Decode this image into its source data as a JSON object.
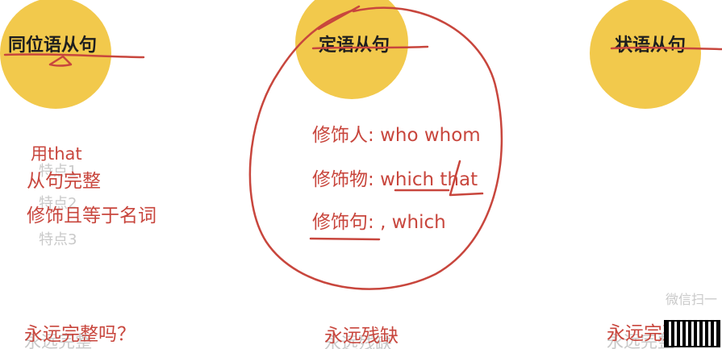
{
  "columns": {
    "appositive": {
      "title": "同位语从句",
      "points": [
        "用that",
        "从句完整",
        "修饰且等于名词"
      ],
      "ghost_points": [
        "特点1",
        "特点2",
        "特点3"
      ],
      "summary": "永远完整吗？",
      "ghost_summary": "永远完整"
    },
    "attributive": {
      "title": "定语从句",
      "rows": [
        {
          "label": "修饰人:",
          "value": "who whom"
        },
        {
          "label": "修饰物:",
          "value": "which that"
        },
        {
          "label": "修饰句:",
          "value": ", which"
        }
      ],
      "summary": "永远残缺",
      "ghost_summary": "永远残缺"
    },
    "adverbial": {
      "title": "状语从句",
      "summary": "永远完整吗",
      "ghost_summary": "永远完整"
    }
  },
  "watermark": {
    "text": "微信扫一"
  },
  "colors": {
    "circle": "#f2c94c",
    "ink": "#c8463d",
    "title": "#1f1f1f",
    "ghost": "#c9c9c9"
  }
}
